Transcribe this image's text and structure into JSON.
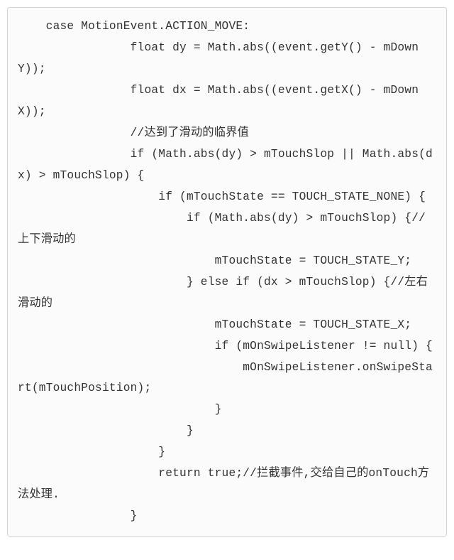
{
  "code": {
    "content": "    case MotionEvent.ACTION_MOVE:\n                float dy = Math.abs((event.getY() - mDownY));\n                float dx = Math.abs((event.getX() - mDownX));\n                //达到了滑动的临界值\n                if (Math.abs(dy) > mTouchSlop || Math.abs(dx) > mTouchSlop) {\n                    if (mTouchState == TOUCH_STATE_NONE) {\n                        if (Math.abs(dy) > mTouchSlop) {//上下滑动的\n                            mTouchState = TOUCH_STATE_Y;\n                        } else if (dx > mTouchSlop) {//左右滑动的\n                            mTouchState = TOUCH_STATE_X;\n                            if (mOnSwipeListener != null) {\n                                mOnSwipeListener.onSwipeStart(mTouchPosition);\n                            }\n                        }\n                    }\n                    return true;//拦截事件,交给自己的onTouch方法处理.\n                }"
  }
}
